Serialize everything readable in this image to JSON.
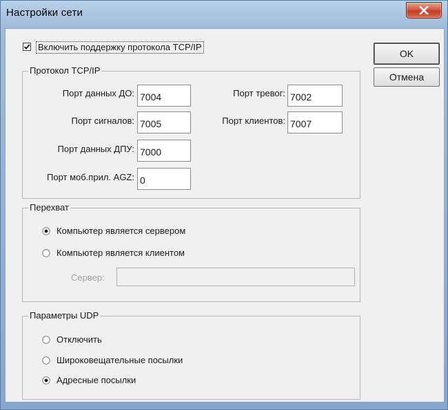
{
  "window": {
    "title": "Настройки сети"
  },
  "tcp_enable": {
    "label": "Включить поддержку протокола TCP/IP",
    "checked": true
  },
  "tcp_group": {
    "title": "Протокол TCP/IP",
    "data_port_do": {
      "label": "Порт данных ДО:",
      "value": "7004"
    },
    "alarm_port": {
      "label": "Порт тревог:",
      "value": "7002"
    },
    "signal_port": {
      "label": "Порт сигналов:",
      "value": "7005"
    },
    "client_port": {
      "label": "Порт клиентов:",
      "value": "7007"
    },
    "data_port_dpu": {
      "label": "Порт данных ДПУ:",
      "value": "7000"
    },
    "mobile_port": {
      "label": "Порт моб.прил. AGZ:",
      "value": "0"
    }
  },
  "intercept_group": {
    "title": "Перехват",
    "options": [
      {
        "label": "Компьютер является сервером",
        "selected": true
      },
      {
        "label": "Компьютер является клиентом",
        "selected": false
      }
    ],
    "server_label": "Сервер:",
    "server_value": ""
  },
  "udp_group": {
    "title": "Параметры UDP",
    "options": [
      {
        "label": "Отключить",
        "selected": false
      },
      {
        "label": "Широковещательные посылки",
        "selected": false
      },
      {
        "label": "Адресные посылки",
        "selected": true
      }
    ]
  },
  "buttons": {
    "ok": "OK",
    "cancel": "Отмена"
  }
}
